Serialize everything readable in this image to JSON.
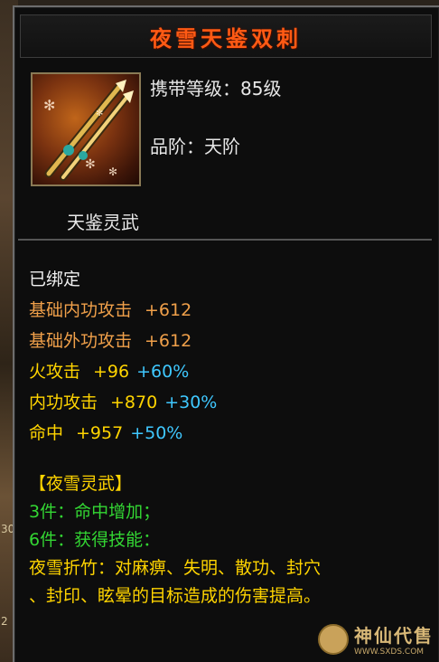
{
  "tooltip": {
    "title": "夜雪天鉴双刺",
    "carry_level_label": "携带等级：",
    "carry_level_value": "85级",
    "grade_label": "品阶：",
    "grade_value": "天阶",
    "subtitle": "天鉴灵武"
  },
  "attributes": {
    "bound": "已绑定",
    "base_inner": {
      "label": "基础内功攻击",
      "value": "+612"
    },
    "base_outer": {
      "label": "基础外功攻击",
      "value": "+612"
    },
    "fire_attack": {
      "label": "火攻击",
      "value": "+96",
      "bonus": "+60%"
    },
    "inner_attack": {
      "label": "内功攻击",
      "value": "+870",
      "bonus": "+30%"
    },
    "hit": {
      "label": "命中",
      "value": "+957",
      "bonus": "+50%"
    }
  },
  "set": {
    "name": "【夜雪灵武】",
    "piece3": "3件：命中增加；",
    "piece6": "6件：获得技能：",
    "skill_line1": "夜雪折竹：对麻痹、失明、散功、封穴",
    "skill_line2": "、封印、眩晕的目标造成的伤害提高。"
  },
  "watermark": {
    "text": "神仙代售",
    "url": "WWW.SXDS.COM"
  },
  "background": {
    "edge_numbers": [
      "30",
      "2"
    ]
  },
  "colors": {
    "title": "#ff5a14",
    "orange_stat": "#f0a04a",
    "yellow_stat": "#ffd400",
    "cyan_bonus": "#3fc8ff",
    "green_set": "#33d633"
  },
  "icons": {
    "item": "twin-daggers-icon"
  }
}
